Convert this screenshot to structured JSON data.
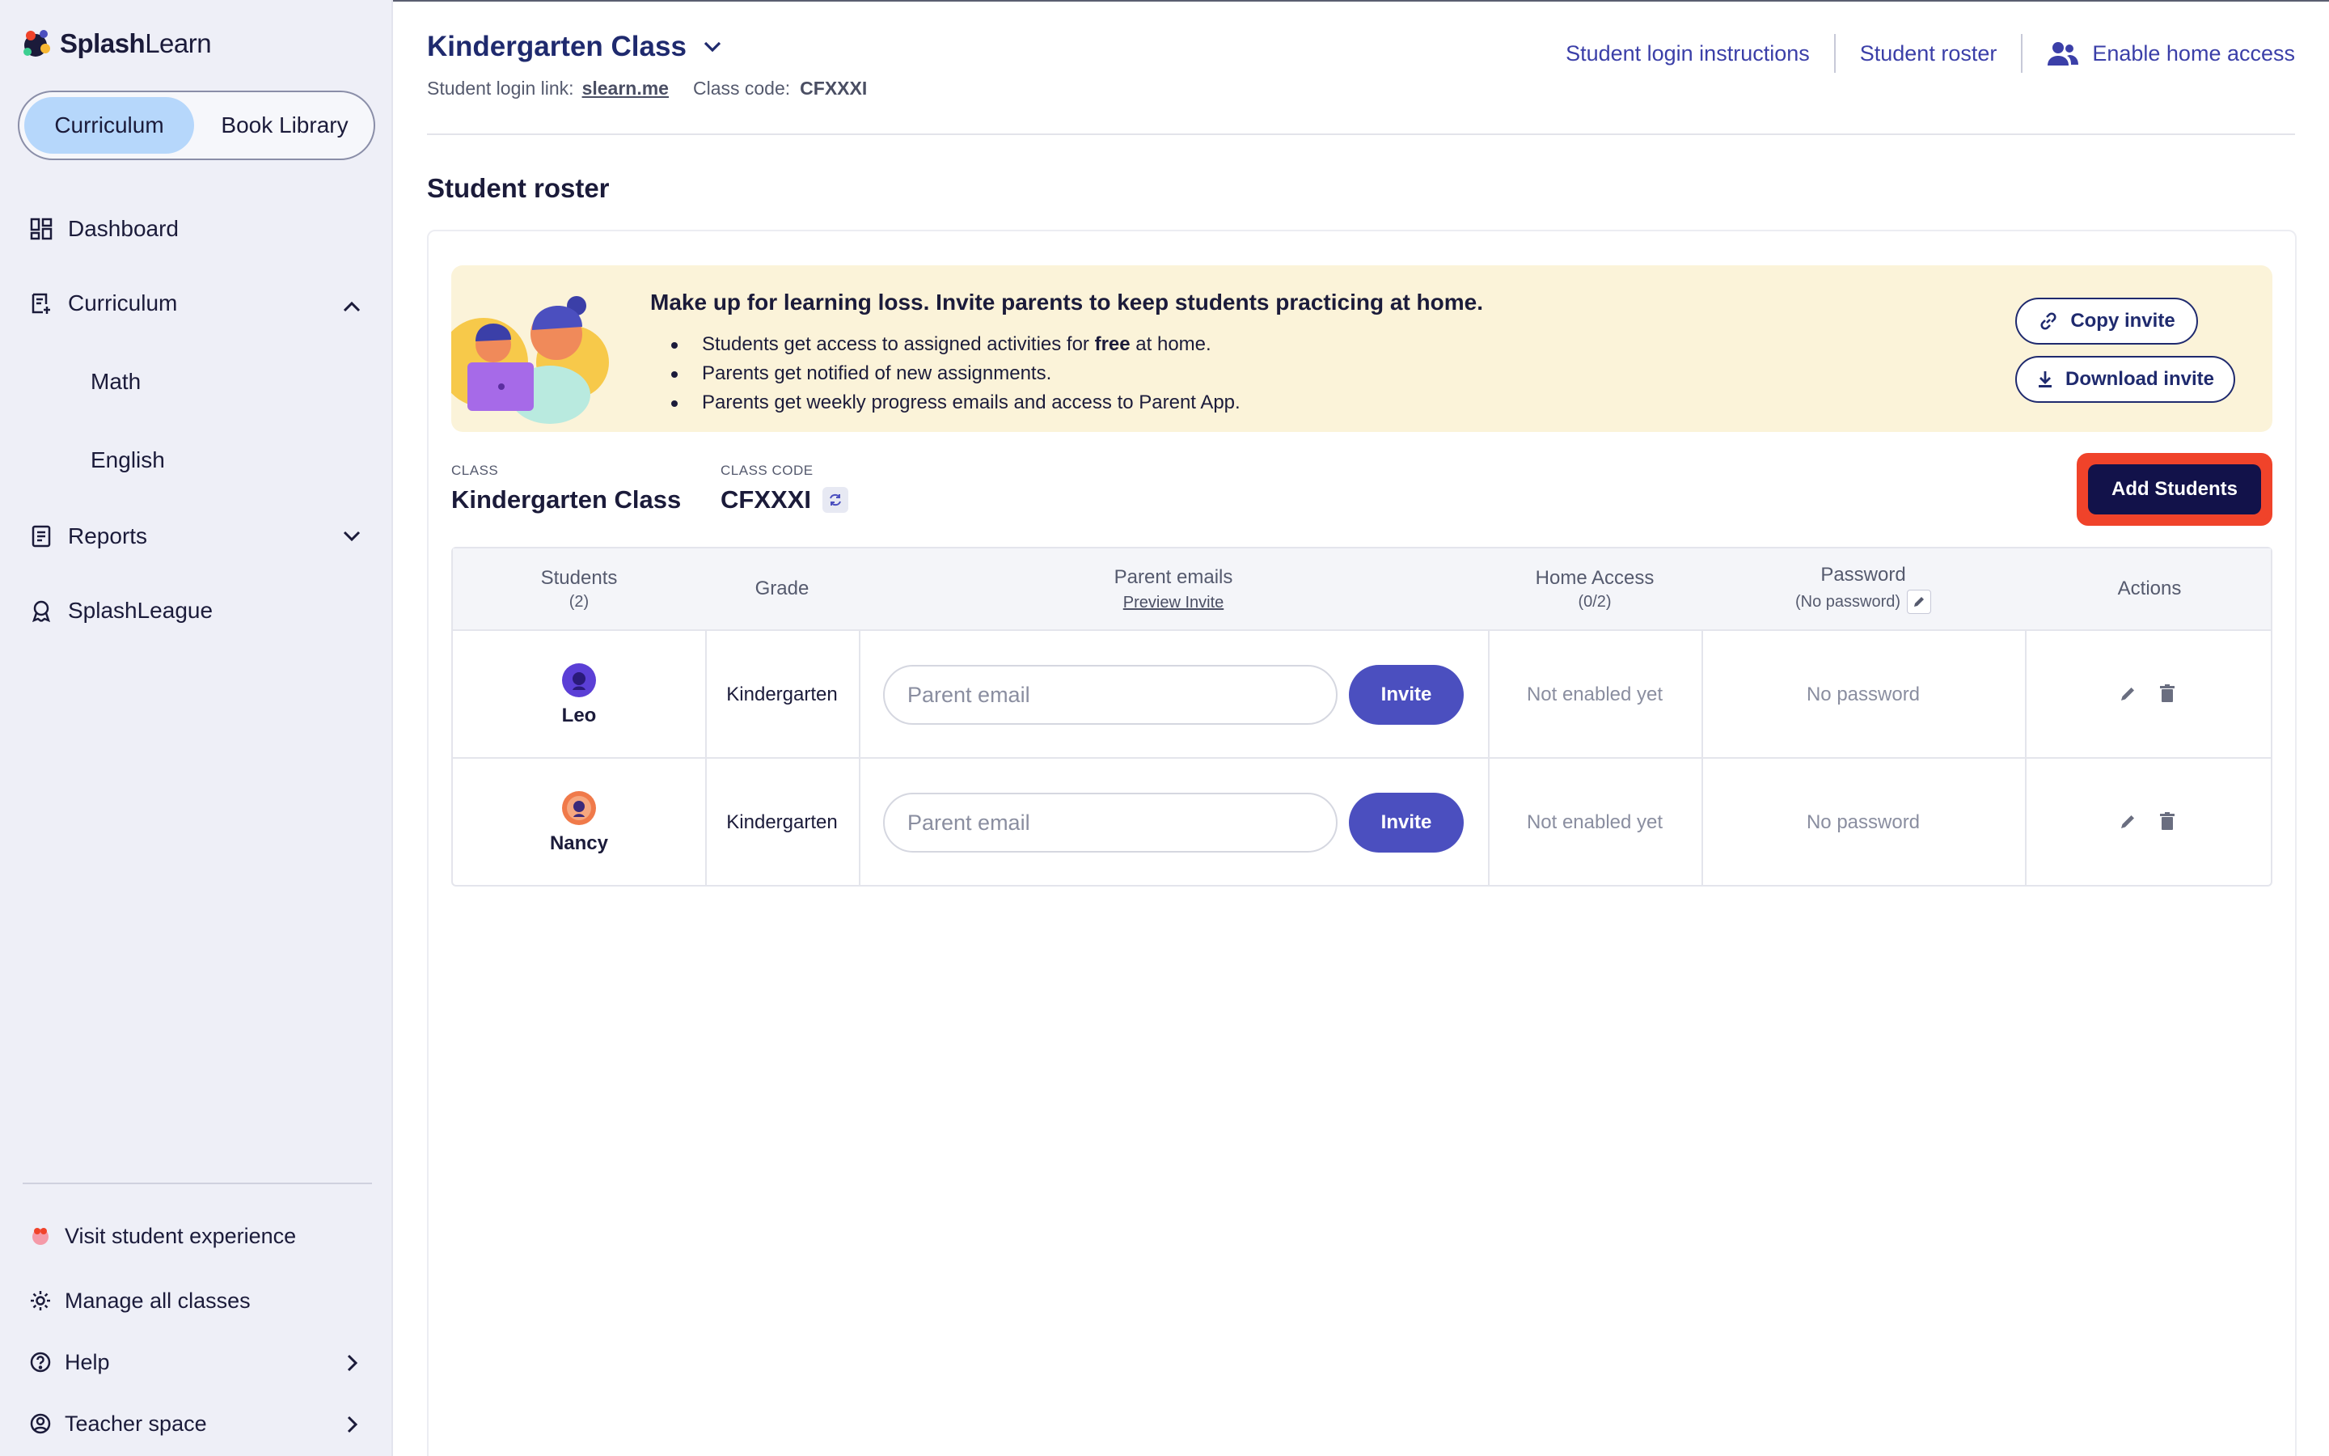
{
  "brand": {
    "name_bold": "Splash",
    "name_thin": "Learn"
  },
  "sidebar": {
    "segment": {
      "active": "Curriculum",
      "inactive": "Book Library"
    },
    "items": [
      {
        "label": "Dashboard",
        "icon": "dashboard-icon"
      },
      {
        "label": "Curriculum",
        "icon": "curriculum-icon"
      },
      {
        "label": "Math"
      },
      {
        "label": "English"
      },
      {
        "label": "Reports",
        "icon": "reports-icon"
      },
      {
        "label": "SplashLeague",
        "icon": "league-icon"
      }
    ],
    "bottom": [
      {
        "label": "Visit student experience",
        "icon": "student-experience-icon"
      },
      {
        "label": "Manage all classes",
        "icon": "gear-icon"
      },
      {
        "label": "Help",
        "icon": "help-icon"
      },
      {
        "label": "Teacher space",
        "icon": "teacher-icon"
      }
    ]
  },
  "header": {
    "class_title": "Kindergarten Class",
    "login_link_label": "Student login link:",
    "login_link": "slearn.me",
    "class_code_label": "Class code:",
    "class_code": "CFXXXI",
    "links": {
      "login_instructions": "Student login instructions",
      "roster": "Student roster",
      "home_access": "Enable home access"
    }
  },
  "section_title": "Student roster",
  "banner": {
    "title": "Make up for learning loss. Invite parents to keep students practicing at home.",
    "bullet1_pre": "Students get access to assigned activities for ",
    "bullet1_bold": "free",
    "bullet1_post": " at home.",
    "bullet2": "Parents get notified of new assignments.",
    "bullet3": "Parents get weekly progress emails and access to Parent App.",
    "copy_invite": "Copy invite",
    "download_invite": "Download invite"
  },
  "class_info": {
    "class_label": "CLASS",
    "class_name": "Kindergarten Class",
    "code_label": "CLASS CODE",
    "code": "CFXXXI",
    "add_students": "Add Students"
  },
  "table": {
    "headers": {
      "students": "Students",
      "students_count": "(2)",
      "grade": "Grade",
      "parent_emails": "Parent emails",
      "preview_invite": "Preview Invite",
      "home_access": "Home Access",
      "home_access_count": "(0/2)",
      "password": "Password",
      "password_sub": "(No password)",
      "actions": "Actions"
    },
    "rows": [
      {
        "name": "Leo",
        "grade": "Kindergarten",
        "email_placeholder": "Parent email",
        "invite": "Invite",
        "home_access": "Not enabled yet",
        "password": "No password",
        "avatar_color": "#5b3fd6"
      },
      {
        "name": "Nancy",
        "grade": "Kindergarten",
        "email_placeholder": "Parent email",
        "invite": "Invite",
        "home_access": "Not enabled yet",
        "password": "No password",
        "avatar_color": "#f07a4a"
      }
    ]
  }
}
